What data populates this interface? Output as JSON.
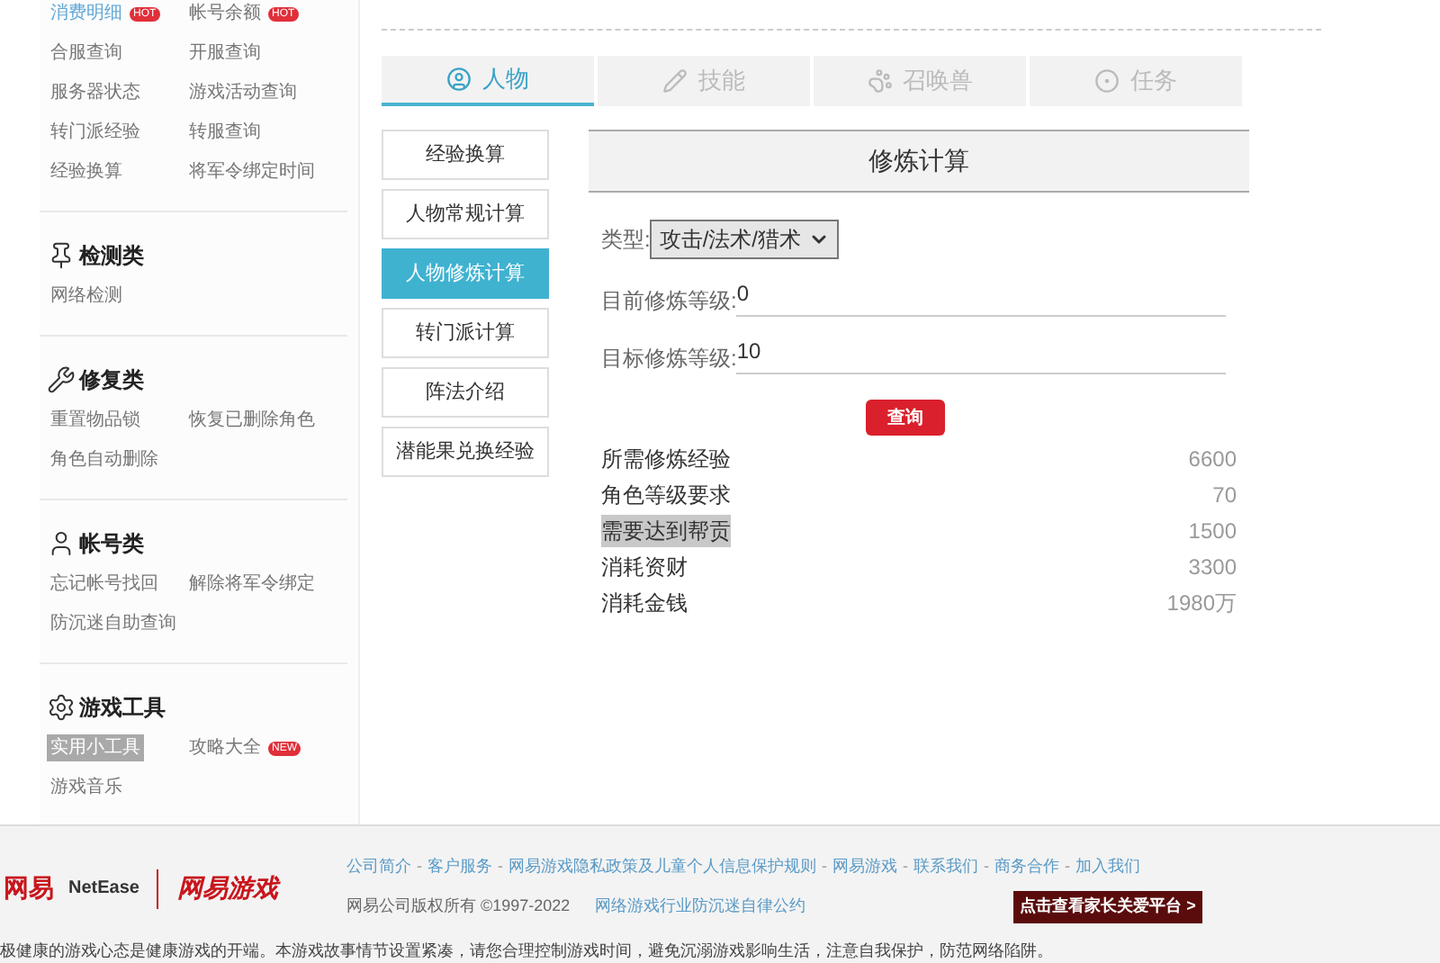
{
  "sidebar": {
    "top_rows": [
      [
        {
          "label": "消费明细",
          "badge": "HOT",
          "selected": false,
          "link": true
        },
        {
          "label": "帐号余额",
          "badge": "HOT",
          "selected": false,
          "link": false
        }
      ],
      [
        {
          "label": "合服查询",
          "selected": false
        },
        {
          "label": "开服查询",
          "selected": false
        }
      ],
      [
        {
          "label": "服务器状态",
          "selected": false
        },
        {
          "label": "游戏活动查询",
          "selected": false
        }
      ],
      [
        {
          "label": "转门派经验",
          "selected": false
        },
        {
          "label": "转服查询",
          "selected": false
        }
      ],
      [
        {
          "label": "经验换算",
          "selected": false
        },
        {
          "label": "将军令绑定时间",
          "selected": false
        }
      ]
    ],
    "sections": [
      {
        "title": "检测类",
        "kind": "pin",
        "items": [
          {
            "label": "网络检测",
            "selected": false
          }
        ]
      },
      {
        "title": "修复类",
        "kind": "wrench",
        "items": [
          {
            "label": "重置物品锁",
            "selected": false
          },
          {
            "label": "恢复已删除角色",
            "selected": false
          },
          {
            "label": "角色自动删除",
            "selected": false
          }
        ]
      },
      {
        "title": "帐号类",
        "kind": "user",
        "items": [
          {
            "label": "忘记帐号找回",
            "selected": false
          },
          {
            "label": "解除将军令绑定",
            "selected": false
          },
          {
            "label": "防沉迷自助查询",
            "selected": false
          }
        ]
      },
      {
        "title": "游戏工具",
        "kind": "gear",
        "items": [
          {
            "label": "实用小工具",
            "selected": true
          },
          {
            "label": "攻略大全",
            "badge": "NEW",
            "selected": false
          },
          {
            "label": "游戏音乐",
            "selected": false
          }
        ]
      }
    ]
  },
  "tabs": [
    {
      "label": "人物",
      "kind": "person",
      "selected": true
    },
    {
      "label": "技能",
      "kind": "pencil",
      "selected": false
    },
    {
      "label": "召唤兽",
      "kind": "paw",
      "selected": false
    },
    {
      "label": "任务",
      "kind": "half",
      "selected": false
    }
  ],
  "subnav": [
    {
      "label": "经验换算",
      "selected": false
    },
    {
      "label": "人物常规计算",
      "selected": false
    },
    {
      "label": "人物修炼计算",
      "selected": true
    },
    {
      "label": "转门派计算",
      "selected": false
    },
    {
      "label": "阵法介绍",
      "selected": false
    },
    {
      "label": "潜能果兑换经验",
      "selected": false
    }
  ],
  "panel": {
    "title": "修炼计算",
    "type_label": "类型:",
    "type_value": "攻击/法术/猎术",
    "fields": [
      {
        "label": "目前修炼等级:",
        "value": "0"
      },
      {
        "label": "目标修炼等级:",
        "value": "10"
      }
    ],
    "button": "查询",
    "results": [
      {
        "label": "所需修炼经验",
        "value": "6600",
        "highlighted": false
      },
      {
        "label": "角色等级要求",
        "value": "70",
        "highlighted": false
      },
      {
        "label": "需要达到帮贡",
        "value": "1500",
        "highlighted": true
      },
      {
        "label": "消耗资财",
        "value": "3300",
        "highlighted": false
      },
      {
        "label": "消耗金钱",
        "value": "1980万",
        "highlighted": false
      }
    ]
  },
  "footer": {
    "logo_cn": "网易",
    "logo_en": "NetEase",
    "logo_game": "网易游戏",
    "separator": "-",
    "links": [
      "公司简介",
      "客户服务",
      "网易游戏隐私政策及儿童个人信息保护规则",
      "网易游戏",
      "联系我们",
      "商务合作",
      "加入我们"
    ],
    "copyright": "网易公司版权所有 ©1997-2022",
    "pact_link": "网络游戏行业防沉迷自律公约",
    "parent_button": "点击查看家长关爱平台 >",
    "notice": "极健康的游戏心态是健康游戏的开端。本游戏故事情节设置紧凑，请您合理控制游戏时间，避免沉溺游戏影响生活，注意自我保护，防范网络陷阱。"
  }
}
